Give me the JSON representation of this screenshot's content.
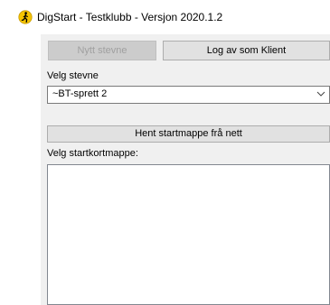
{
  "window": {
    "title": "DigStart - Testklubb - Versjon 2020.1.2"
  },
  "toolbar": {
    "new_meet_label": "Nytt stevne",
    "logout_client_label": "Log av som Klient"
  },
  "meet": {
    "label": "Velg stevne",
    "selected": "~BT-sprett 2"
  },
  "fetch_button_label": "Hent startmappe frå nett",
  "startcard": {
    "label": "Velg startkortmappe:"
  },
  "colors": {
    "client_bg": "#f0f0f0",
    "button_bg": "#e1e1e1",
    "icon_yellow": "#f5c400"
  }
}
